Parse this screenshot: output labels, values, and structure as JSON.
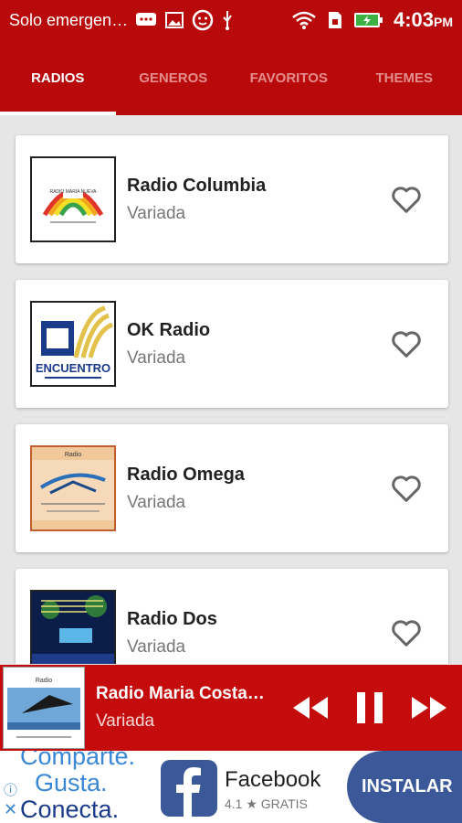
{
  "status_bar": {
    "carrier": "Solo emergen…",
    "time": "4:03",
    "ampm": "PM"
  },
  "tabs": [
    {
      "label": "RADIOS",
      "active": true
    },
    {
      "label": "GENEROS",
      "active": false
    },
    {
      "label": "FAVORITOS",
      "active": false
    },
    {
      "label": "THEMES",
      "active": false
    }
  ],
  "stations": [
    {
      "name": "Radio Columbia",
      "genre": "Variada",
      "logo_text": "RADIO MARIA NUEVA"
    },
    {
      "name": "OK Radio",
      "genre": "Variada",
      "logo_text": "ENCUENTRO"
    },
    {
      "name": "Radio Omega",
      "genre": "Variada",
      "logo_text": "Radio"
    },
    {
      "name": "Radio Dos",
      "genre": "Variada",
      "logo_text": ""
    }
  ],
  "player": {
    "title": "Radio Maria Costa…",
    "genre": "Variada",
    "thumb_text": "Radio"
  },
  "ad": {
    "slogan": [
      "Comparte.",
      "Gusta.",
      "Conecta."
    ],
    "app_name": "Facebook",
    "rating": "4.1 ★ GRATIS",
    "cta": "INSTALAR"
  },
  "colors": {
    "primary": "#b80a0a",
    "player": "#c40c0c",
    "facebook": "#3b5998"
  },
  "icons": [
    "message-icon",
    "image-icon",
    "face-icon",
    "usb-icon",
    "wifi-icon",
    "sim-icon",
    "battery-icon",
    "heart-outline-icon",
    "rewind-icon",
    "pause-icon",
    "fast-forward-icon"
  ]
}
